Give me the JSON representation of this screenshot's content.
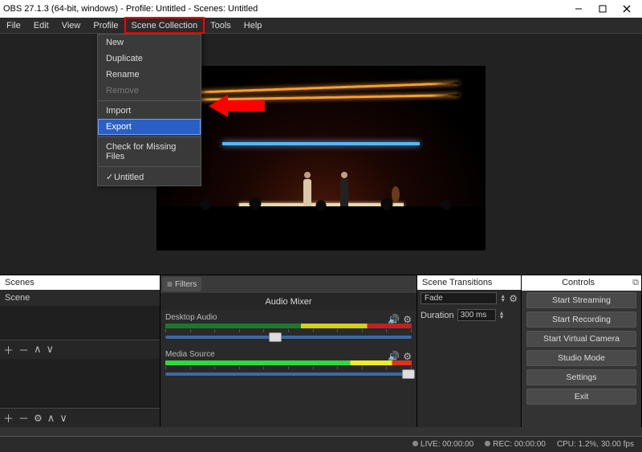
{
  "titlebar": {
    "title": "OBS 27.1.3 (64-bit, windows) - Profile: Untitled - Scenes: Untitled"
  },
  "menubar": {
    "items": [
      "File",
      "Edit",
      "View",
      "Profile",
      "Scene Collection",
      "Tools",
      "Help"
    ]
  },
  "dropdown": {
    "new": "New",
    "duplicate": "Duplicate",
    "rename": "Rename",
    "remove": "Remove",
    "import": "Import",
    "export": "Export",
    "check": "Check for Missing Files",
    "untitled": "Untitled"
  },
  "scenes": {
    "title": "Scenes",
    "items": [
      "Scene"
    ]
  },
  "mixer": {
    "filters": "Filters",
    "title": "Audio Mixer",
    "ch1": "Desktop Audio",
    "ch2": "Media Source"
  },
  "transitions": {
    "title": "Scene Transitions",
    "select": "Fade",
    "dur_label": "Duration",
    "dur_value": "300 ms"
  },
  "controls": {
    "title": "Controls",
    "start_streaming": "Start Streaming",
    "start_recording": "Start Recording",
    "virtual_cam": "Start Virtual Camera",
    "studio": "Studio Mode",
    "settings": "Settings",
    "exit": "Exit"
  },
  "status": {
    "live": "LIVE: 00:00:00",
    "rec": "REC: 00:00:00",
    "cpu": "CPU: 1.2%, 30.00 fps"
  }
}
